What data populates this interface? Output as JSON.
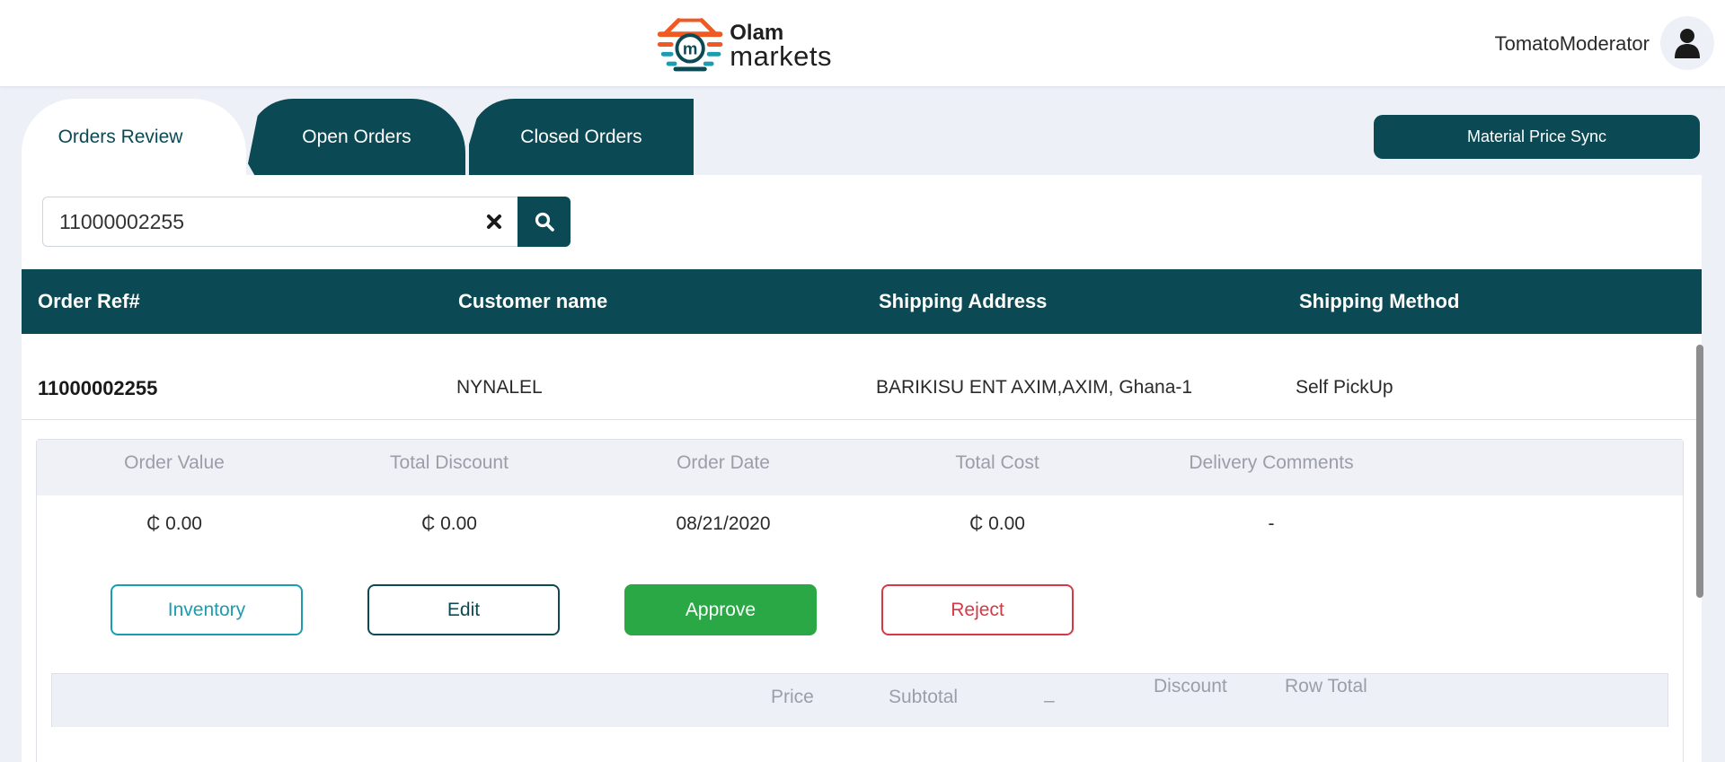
{
  "brand": {
    "name_line1": "Olam",
    "name_line2": "markets",
    "colors": {
      "primary": "#0b4a54",
      "approve": "#29a845",
      "reject": "#d43a46",
      "inventory": "#1c9cae",
      "logo_orange": "#f05a22",
      "logo_teal": "#1c9cae"
    }
  },
  "header": {
    "username": "TomatoModerator",
    "avatar_icon": "user-icon"
  },
  "tabs": [
    {
      "label": "Orders Review",
      "active": true
    },
    {
      "label": "Open Orders",
      "active": false
    },
    {
      "label": "Closed Orders",
      "active": false
    }
  ],
  "sync_button": {
    "label": "Material Price Sync"
  },
  "search": {
    "value": "11000002255",
    "clear_icon": "close-icon",
    "search_icon": "search-icon"
  },
  "table": {
    "headers": [
      "Order Ref#",
      "Customer name",
      "Shipping Address",
      "Shipping Method"
    ],
    "rows": [
      {
        "order_ref": "11000002255",
        "customer": "NYNALEL",
        "address": "BARIKISU ENT AXIM,AXIM, Ghana-1",
        "method": "Self PickUp"
      }
    ]
  },
  "order_detail": {
    "headers": [
      "Order Value",
      "Total Discount",
      "Order Date",
      "Total Cost",
      "Delivery Comments"
    ],
    "values": [
      "₵ 0.00",
      "₵ 0.00",
      "08/21/2020",
      "₵ 0.00",
      "-"
    ],
    "actions": {
      "inventory": "Inventory",
      "edit": "Edit",
      "approve": "Approve",
      "reject": "Reject"
    }
  },
  "items_table": {
    "headers": [
      "Price",
      "Subtotal",
      "–",
      "Discount",
      "Row Total"
    ]
  }
}
